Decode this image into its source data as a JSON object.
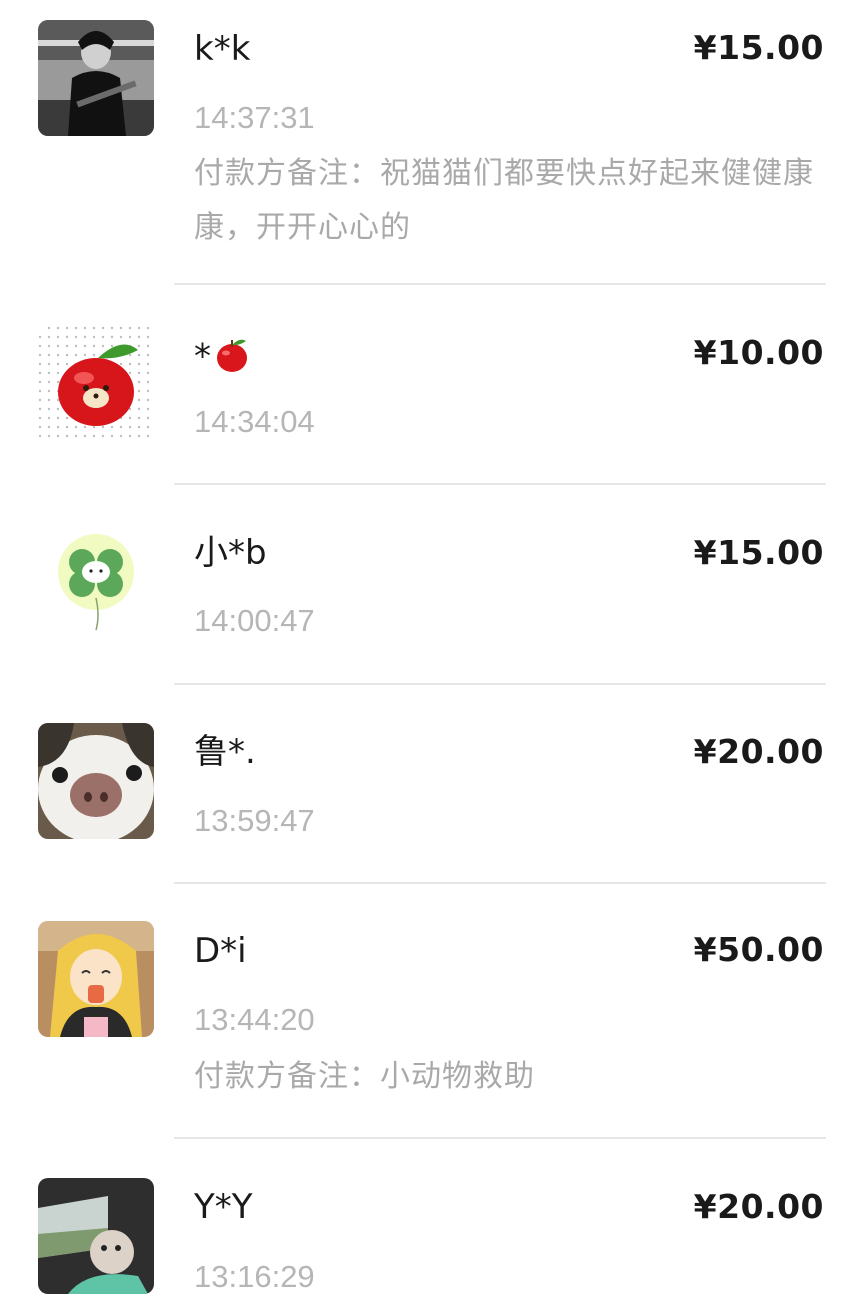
{
  "records": [
    {
      "name": "k*k",
      "amount": "¥15.00",
      "time": "14:37:31",
      "note": "付款方备注：祝猫猫们都要快点好起来健健康康，开开心心的",
      "avatar": "guitarist-photo"
    },
    {
      "name": "*",
      "name_icon": "apple-emoji",
      "amount": "¥10.00",
      "time": "14:34:04",
      "avatar": "apple-bear-avatar"
    },
    {
      "name": "小*b",
      "amount": "¥15.00",
      "time": "14:00:47",
      "avatar": "clover-bear-avatar"
    },
    {
      "name": "鲁*.",
      "amount": "¥20.00",
      "time": "13:59:47",
      "avatar": "cat-closeup-photo"
    },
    {
      "name": "D*i",
      "amount": "¥50.00",
      "time": "13:44:20",
      "note": "付款方备注：小动物救助",
      "avatar": "anime-girl-avatar"
    },
    {
      "name": "Y*Y",
      "amount": "¥20.00",
      "time": "13:16:29",
      "avatar": "dog-in-car-photo"
    }
  ]
}
